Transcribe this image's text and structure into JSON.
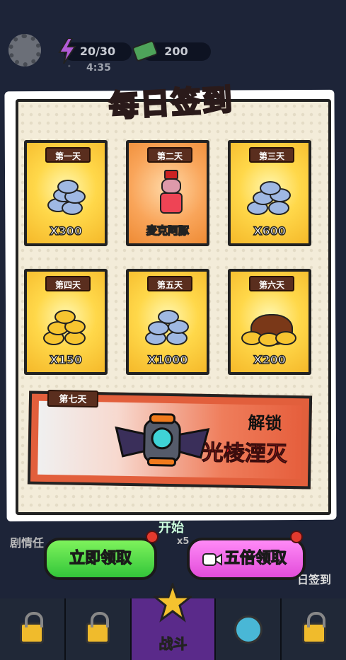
{
  "topbar": {
    "energy": "20/30",
    "timer": "4:35",
    "tickets": "200"
  },
  "popup": {
    "title": "每日签到",
    "days": [
      {
        "label": "第一天",
        "reward": "X300",
        "item": "silver-coins"
      },
      {
        "label": "第二天",
        "reward": "麦克阿豚",
        "item": "character"
      },
      {
        "label": "第三天",
        "reward": "X600",
        "item": "silver-coins"
      },
      {
        "label": "第四天",
        "reward": "X150",
        "item": "gold-coins"
      },
      {
        "label": "第五天",
        "reward": "X1000",
        "item": "silver-coins"
      },
      {
        "label": "第六天",
        "reward": "X200",
        "item": "gold-bag"
      }
    ],
    "day7": {
      "label": "第七天",
      "unlock": "解锁",
      "name": "光棱湮灭"
    }
  },
  "underlying": {
    "story": "剧情任",
    "start": "开始",
    "stamina": "x5",
    "checkin": "日签到"
  },
  "buttons": {
    "claim": "立即领取",
    "claim_x5": "五倍领取"
  },
  "nav": {
    "battle": "战斗"
  },
  "colors": {
    "green_button": "#33c63a",
    "pink_button": "#e24cd9",
    "banner": "#e25f3c",
    "title": "#ff6f7a"
  }
}
